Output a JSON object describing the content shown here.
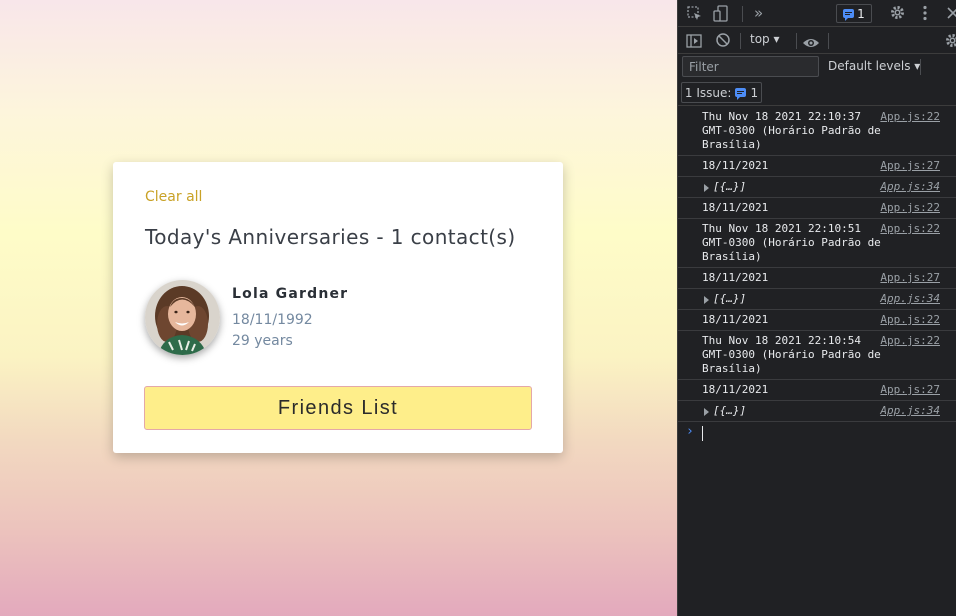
{
  "card": {
    "clear_all": "Clear all",
    "title": "Today's Anniversaries - 1 contact(s)",
    "contact": {
      "name": "Lola Gardner",
      "birthdate": "18/11/1992",
      "age": "29 years"
    },
    "friends_button": "Friends List"
  },
  "devtools": {
    "message_count": "1",
    "context": "top",
    "filter_placeholder": "Filter",
    "levels": "Default levels",
    "issues_label": "1 Issue:",
    "issues_count": "1",
    "logs": [
      {
        "text": "Thu Nov 18 2021 22:10:37 GMT-0300 (Horário Padrão de Brasília)",
        "source": "App.js:22"
      },
      {
        "text": "18/11/2021",
        "source": "App.js:27"
      },
      {
        "text": "[{…}]",
        "source": "App.js:34"
      },
      {
        "text": "18/11/2021",
        "source": "App.js:22"
      },
      {
        "text": "Thu Nov 18 2021 22:10:51 GMT-0300 (Horário Padrão de Brasília)",
        "source": "App.js:22"
      },
      {
        "text": "18/11/2021",
        "source": "App.js:27"
      },
      {
        "text": "[{…}]",
        "source": "App.js:34"
      },
      {
        "text": "18/11/2021",
        "source": "App.js:22"
      },
      {
        "text": "Thu Nov 18 2021 22:10:54 GMT-0300 (Horário Padrão de Brasília)",
        "source": "App.js:22"
      },
      {
        "text": "18/11/2021",
        "source": "App.js:27"
      },
      {
        "text": "[{…}]",
        "source": "App.js:34"
      }
    ]
  },
  "colors": {
    "accent_link": "#c9a227",
    "button_bg": "#feee8a",
    "devtools_bg": "#202124",
    "devtools_blue": "#4d8df7"
  }
}
